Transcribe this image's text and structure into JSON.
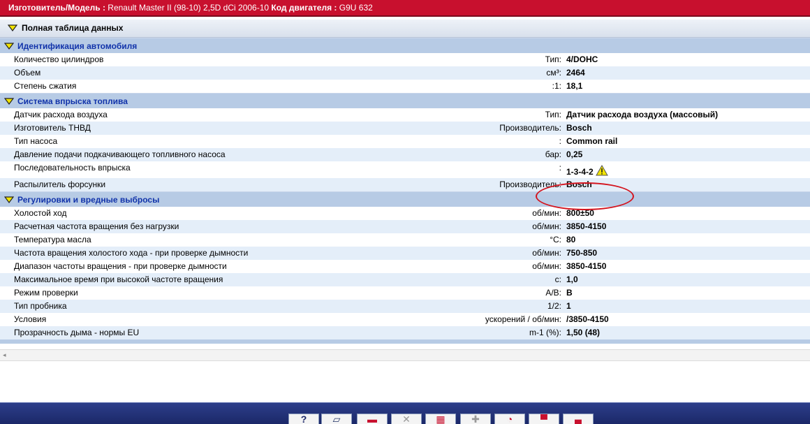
{
  "header": {
    "model_label": "Изготовитель/Модель :",
    "model_value": "Renault Master II (98-10) 2,5D dCi 2006-10",
    "engine_label": "Код двигателя :",
    "engine_value": "G9U 632"
  },
  "title": "Полная таблица данных",
  "sections": [
    {
      "title": "Идентификация автомобиля",
      "rows": [
        {
          "name": "Количество цилиндров",
          "unit": "Тип:",
          "value": "4/DOHC"
        },
        {
          "name": "Объем",
          "unit": "см³:",
          "value": "2464"
        },
        {
          "name": "Степень сжатия",
          "unit": ":1:",
          "value": "18,1"
        }
      ]
    },
    {
      "title": "Система впрыска топлива",
      "rows": [
        {
          "name": "Датчик расхода воздуха",
          "unit": "Тип:",
          "value": "Датчик расхода воздуха (массовый)"
        },
        {
          "name": "Изготовитель ТНВД",
          "unit": "Производитель:",
          "value": "Bosch"
        },
        {
          "name": "Тип насоса",
          "unit": ":",
          "value": "Common rail"
        },
        {
          "name": "Давление подачи подкачивающего топливного насоса",
          "unit": "бар:",
          "value": "0,25"
        },
        {
          "name": "Последовательность впрыска",
          "unit": ":",
          "value": "1-3-4-2"
        },
        {
          "name": "Распылитель форсунки",
          "unit": "Производитель:",
          "value": "Bosch"
        }
      ]
    },
    {
      "title": "Регулировки и вредные выбросы",
      "rows": [
        {
          "name": "Холостой ход",
          "unit": "об/мин:",
          "value": "800±50"
        },
        {
          "name": "Расчетная частота вращения без нагрузки",
          "unit": "об/мин:",
          "value": "3850-4150"
        },
        {
          "name": "Температура масла",
          "unit": "°C:",
          "value": "80"
        },
        {
          "name": "Частота вращения холостого хода - при проверке дымности",
          "unit": "об/мин:",
          "value": "750-850"
        },
        {
          "name": "Диапазон частоты вращения - при проверке дымности",
          "unit": "об/мин:",
          "value": "3850-4150"
        },
        {
          "name": "Максимальное время при высокой частоте вращения",
          "unit": "с:",
          "value": "1,0"
        },
        {
          "name": "Режим проверки",
          "unit": "A/B:",
          "value": "B"
        },
        {
          "name": "Тип пробника",
          "unit": "1/2:",
          "value": "1"
        },
        {
          "name": "Условия",
          "unit": "ускорений / об/мин:",
          "value": "/3850-4150"
        },
        {
          "name": "Прозрачность дыма - нормы EU",
          "unit": "m-1 (%):",
          "value": "1,50 (48)"
        }
      ]
    }
  ],
  "toolbar": {
    "buttons": [
      {
        "icon": "help-icon",
        "glyph": "?"
      },
      {
        "icon": "print-icon",
        "glyph": "▱"
      },
      {
        "icon": "red-panel-icon",
        "glyph": "▬"
      },
      {
        "icon": "tools-icon",
        "glyph": "✕"
      },
      {
        "icon": "calendar-icon",
        "glyph": "▦"
      },
      {
        "icon": "add-icon",
        "glyph": "✚"
      },
      {
        "icon": "gauge-icon",
        "glyph": "◔"
      },
      {
        "icon": "car-icon",
        "glyph": "▀"
      },
      {
        "icon": "battery-icon",
        "glyph": "▄"
      }
    ]
  },
  "colors": {
    "header_bg": "#c8102e",
    "section_bg": "#b7cbe5",
    "section_text": "#1133aa",
    "row_alt_bg": "#e4eef9",
    "annotation": "#d4141e",
    "toolbar_bg": "#1b2868",
    "chevron": "#f2e400"
  }
}
